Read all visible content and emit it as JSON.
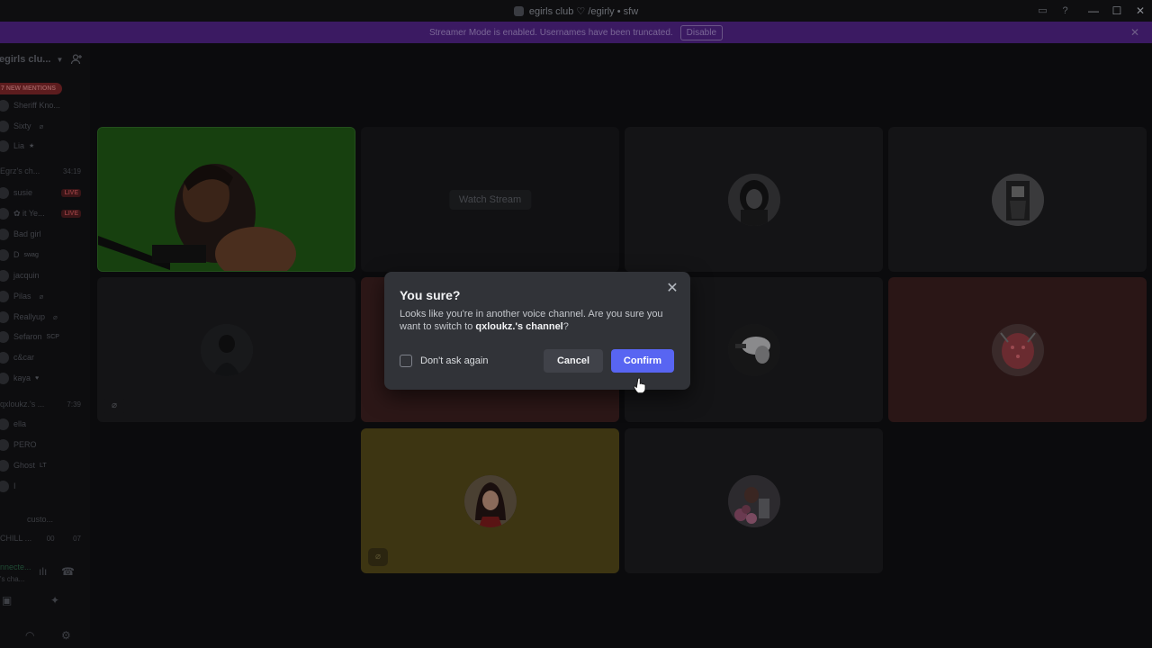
{
  "window": {
    "title": "egirls club ♡ /egirly • sfw",
    "icons": [
      "inbox-icon",
      "help-icon"
    ],
    "controls": [
      "minimize",
      "maximize",
      "close"
    ]
  },
  "banner": {
    "message": "Streamer Mode is enabled. Usernames have been truncated.",
    "action": "Disable",
    "color": "#3b1a62"
  },
  "sidebar": {
    "server_name": "egirls clu...",
    "mentions_badge": "7 NEW MENTIONS",
    "channels": [
      {
        "name": "Sheriff Kno...",
        "tag": ""
      },
      {
        "name": "Sixty",
        "tag": ""
      },
      {
        "name": "Lia",
        "tag": "★"
      }
    ],
    "categories": [
      {
        "name": "Egrz's ch...",
        "time": "34:19"
      },
      {
        "name": "qxloukz.'s ...",
        "time": "7:39"
      }
    ],
    "members_a": [
      {
        "name": "susie",
        "badge": "LIVE"
      },
      {
        "name": "✿ it Ye...",
        "badge": "LIVE"
      },
      {
        "name": "Bad girl",
        "badge": ""
      },
      {
        "name": "D",
        "badge": "swag"
      },
      {
        "name": "jacquin",
        "badge": ""
      },
      {
        "name": "Pilas",
        "badge": ""
      },
      {
        "name": "Reallyup",
        "badge": ""
      },
      {
        "name": "Sefaron",
        "badge": "SCP"
      },
      {
        "name": "c&car",
        "badge": ""
      },
      {
        "name": "kaya",
        "badge": ""
      }
    ],
    "members_b": [
      {
        "name": "ella",
        "badge": ""
      },
      {
        "name": "PERO",
        "badge": ""
      },
      {
        "name": "Ghost",
        "badge": "LT"
      },
      {
        "name": "I",
        "badge": ""
      }
    ],
    "custom_label": "custo...",
    "chill_label": "CHILL ...",
    "chill_counts": [
      "00",
      "07"
    ],
    "connection": "nnecte...",
    "connection_sub": "'s cha..."
  },
  "tiles": {
    "watch_stream_label": "Watch Stream"
  },
  "modal": {
    "title": "You sure?",
    "body_prefix": "Looks like you're in another voice channel. Are you sure you want to switch to ",
    "channel_name": "qxloukz.'s channel",
    "body_suffix": "?",
    "checkbox_label": "Don't ask again",
    "cancel_label": "Cancel",
    "confirm_label": "Confirm",
    "confirm_color": "#5865f2"
  }
}
